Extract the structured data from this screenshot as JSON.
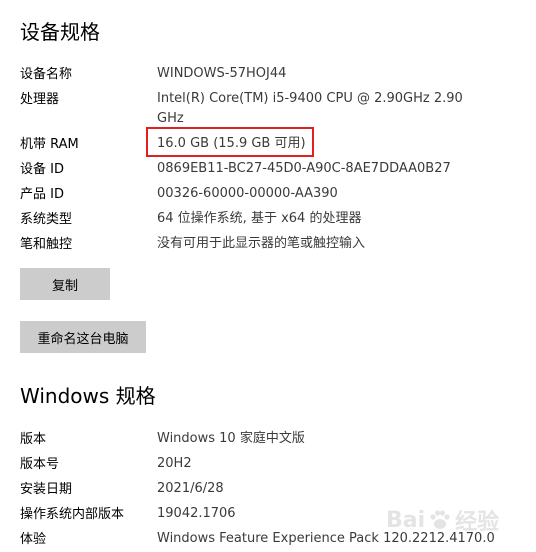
{
  "device_specs": {
    "title": "设备规格",
    "rows": [
      {
        "label": "设备名称",
        "value": "WINDOWS-57HOJ44"
      },
      {
        "label": "处理器",
        "value": "Intel(R) Core(TM) i5-9400 CPU @ 2.90GHz   2.90 GHz"
      },
      {
        "label": "机带 RAM",
        "value": "16.0 GB (15.9 GB 可用)"
      },
      {
        "label": "设备 ID",
        "value": "0869EB11-BC27-45D0-A90C-8AE7DDAA0B27"
      },
      {
        "label": "产品 ID",
        "value": "00326-60000-00000-AA390"
      },
      {
        "label": "系统类型",
        "value": "64 位操作系统, 基于 x64 的处理器"
      },
      {
        "label": "笔和触控",
        "value": "没有可用于此显示器的笔或触控输入"
      }
    ],
    "highlight_color": "#e02020"
  },
  "buttons": {
    "copy_label": "复制",
    "rename_label": "重命名这台电脑"
  },
  "windows_specs": {
    "title": "Windows 规格",
    "rows": [
      {
        "label": "版本",
        "value": "Windows 10 家庭中文版"
      },
      {
        "label": "版本号",
        "value": "20H2"
      },
      {
        "label": "安装日期",
        "value": "2021/6/28"
      },
      {
        "label": "操作系统内部版本",
        "value": "19042.1706"
      },
      {
        "label": "体验",
        "value": "Windows Feature Experience Pack 120.2212.4170.0"
      }
    ]
  },
  "watermark": {
    "text_left": "Bai",
    "text_right": "经验"
  }
}
